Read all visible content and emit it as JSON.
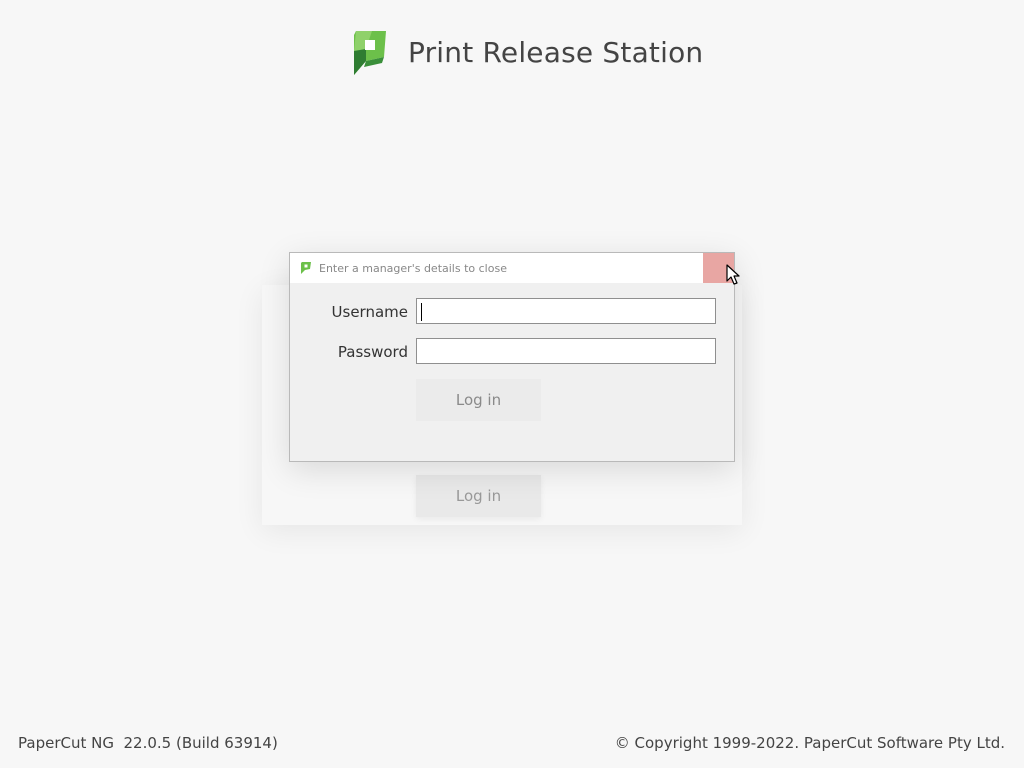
{
  "header": {
    "title": "Print Release Station",
    "logo_icon": "papercut-logo-icon"
  },
  "dialog": {
    "title": "Enter a manager's details to close",
    "title_icon": "papercut-small-icon",
    "username_label": "Username",
    "username_value": "",
    "password_label": "Password",
    "password_value": "",
    "login_label": "Log in",
    "close_color": "#e8a6a3"
  },
  "background": {
    "login_label": "Log in"
  },
  "footer": {
    "version": "PaperCut NG  22.0.5 (Build 63914)",
    "copyright": "© Copyright 1999-2022. PaperCut Software Pty Ltd."
  },
  "colors": {
    "logo_green": "#5cb85c",
    "logo_dark": "#3a8f3a",
    "background": "#f7f7f7"
  }
}
